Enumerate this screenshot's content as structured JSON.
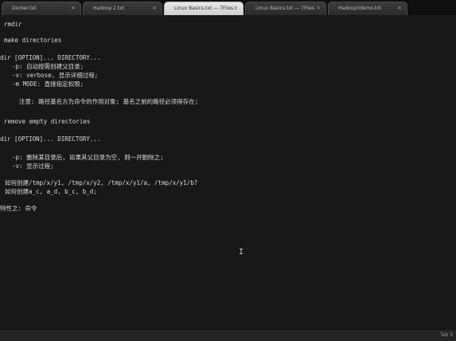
{
  "tabs": [
    {
      "label": "Docker.txt",
      "close": "×"
    },
    {
      "label": "Hadoop 2.txt",
      "close": "×"
    },
    {
      "label": "Linux Basics.txt — 7Files",
      "close": "×"
    },
    {
      "label": "Linux Basics.txt — 7Files",
      "close": "×"
    },
    {
      "label": "Hadoop3demo.txt",
      "close": "×"
    }
  ],
  "active_tab": 2,
  "editor": {
    "lines": [
      "rmdir",
      "make directories",
      "dir [OPTION]... DIRECTORY...",
      "  -p: 自动按需创建父目录;",
      "  -v: verbose, 显示详细过程;",
      "  -m MODE: 直接指定权限;",
      "    注意: 路径基名方为命令的作用对象; 基名之前的路径必须得存在;",
      "remove empty directories",
      "dir [OPTION]... DIRECTORY...",
      "  -p: 删除某目录后, 如果其父目录为空, 则一并删除之;",
      "  -v: 显示过程;",
      "如何创建/tmp/x/y1, /tmp/x/y2, /tmp/x/y1/a, /tmp/x/y1/b?",
      "如何创建a_c, a_d, b_c, b_d;",
      "特性之: 命令"
    ],
    "cursor": "I"
  },
  "status": {
    "right": "Tab S"
  }
}
